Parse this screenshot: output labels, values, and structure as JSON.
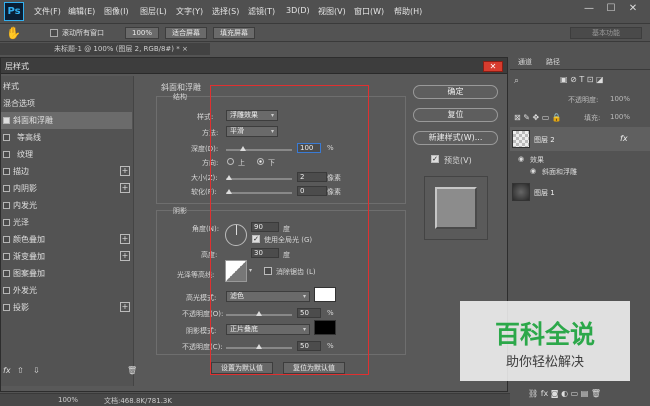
{
  "menubar": {
    "logo": "Ps",
    "items": [
      "文件(F)",
      "编辑(E)",
      "图像(I)",
      "图层(L)",
      "文字(Y)",
      "选择(S)",
      "滤镜(T)",
      "3D(D)",
      "视图(V)",
      "窗口(W)",
      "帮助(H)"
    ],
    "min": "—",
    "max": "☐",
    "close": "✕"
  },
  "optbar": {
    "scroll_all": "滚动所有窗口",
    "zoom": "100%",
    "fit_screen": "适合屏幕",
    "fill_screen": "填充屏幕",
    "workspace": "基本功能"
  },
  "doc": {
    "tab": "未标题-1 @ 100% (图层 2, RGB/8#) * ×",
    "zoom": "100%",
    "info": "文档:468.8K/781.3K"
  },
  "dialog": {
    "title": "层样式",
    "close": "✕",
    "styles": [
      {
        "label": "样式",
        "check": false,
        "plus": false,
        "active": false
      },
      {
        "label": "混合选项",
        "check": false,
        "plus": false,
        "active": false
      },
      {
        "label": "斜面和浮雕",
        "check": true,
        "plus": false,
        "active": true
      },
      {
        "label": "等高线",
        "check": true,
        "plus": false,
        "active": false,
        "indent": true
      },
      {
        "label": "纹理",
        "check": true,
        "plus": false,
        "active": false,
        "indent": true
      },
      {
        "label": "描边",
        "check": true,
        "plus": true,
        "active": false
      },
      {
        "label": "内阴影",
        "check": true,
        "plus": true,
        "active": false
      },
      {
        "label": "内发光",
        "check": true,
        "plus": false,
        "active": false
      },
      {
        "label": "光泽",
        "check": true,
        "plus": false,
        "active": false
      },
      {
        "label": "颜色叠加",
        "check": true,
        "plus": true,
        "active": false
      },
      {
        "label": "渐变叠加",
        "check": true,
        "plus": true,
        "active": false
      },
      {
        "label": "图案叠加",
        "check": true,
        "plus": false,
        "active": false
      },
      {
        "label": "外发光",
        "check": true,
        "plus": false,
        "active": false
      },
      {
        "label": "投影",
        "check": true,
        "plus": true,
        "active": false
      }
    ],
    "bevel": {
      "section": "斜面和浮雕",
      "structure": "结构",
      "style_label": "样式:",
      "style_value": "浮雕效果",
      "method_label": "方法:",
      "method_value": "平滑",
      "depth_label": "深度(D):",
      "depth_value": "100",
      "depth_unit": "%",
      "depth_level": 0.25,
      "direction_label": "方向:",
      "dir_up": "上",
      "dir_down": "下",
      "size_label": "大小(Z):",
      "size_value": "2",
      "size_unit": "像素",
      "soften_label": "软化(F):",
      "soften_value": "0",
      "soften_unit": "像素"
    },
    "shading": {
      "section": "阴影",
      "angle_label": "角度(N):",
      "angle_value": "90",
      "angle_unit": "度",
      "global_light": "使用全局光 (G)",
      "altitude_label": "高度:",
      "altitude_value": "30",
      "altitude_unit": "度",
      "gloss_label": "光泽等高线:",
      "anti_alias": "消除锯齿 (L)",
      "highlight_label": "高光模式:",
      "highlight_value": "滤色",
      "highlight_color": "#ffffff",
      "opacity1_label": "不透明度(O):",
      "opacity1_value": "50",
      "opacity1_unit": "%",
      "shadow_label": "阴影模式:",
      "shadow_value": "正片叠底",
      "shadow_color": "#000000",
      "opacity2_label": "不透明度(C):",
      "opacity2_value": "50",
      "opacity2_unit": "%"
    },
    "set_default": "设置为默认值",
    "reset_default": "复位为默认值",
    "ok": "确定",
    "reset": "复位",
    "new_style": "新建样式(W)...",
    "preview": "预览(V)",
    "fx_label": "fx"
  },
  "panel": {
    "tabs": [
      "通道",
      "路径"
    ],
    "opacity_label": "不透明度:",
    "opacity_value": "100%",
    "fill_label": "填充:",
    "fill_value": "100%",
    "layers": [
      "图层 2",
      "效果",
      "斜面和浮雕",
      "图层 1"
    ],
    "fx": "fx"
  },
  "watermark": {
    "title": "百科全说",
    "subtitle": "助你轻松解决"
  },
  "colors": {
    "accent": "#d83c2e",
    "watermark_green": "#2ca84a",
    "guide_red": "#e03030"
  }
}
